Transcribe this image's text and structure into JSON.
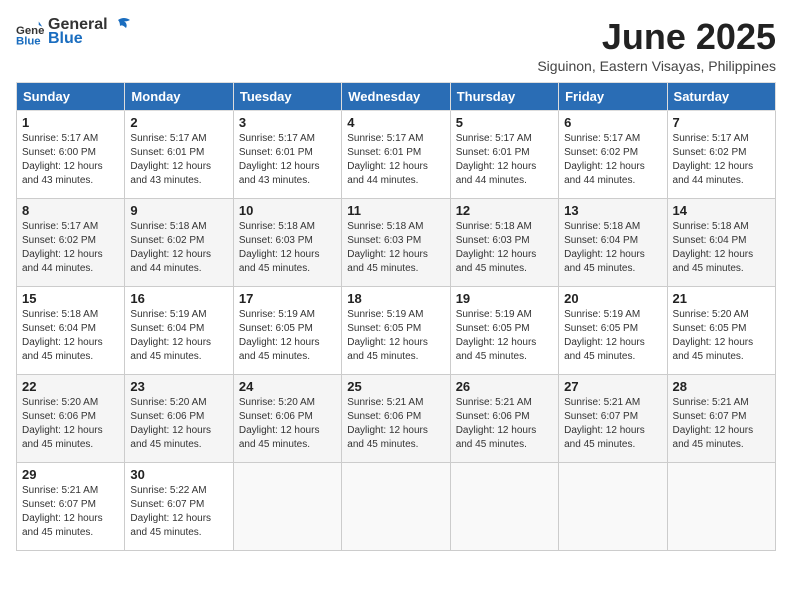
{
  "header": {
    "logo_general": "General",
    "logo_blue": "Blue",
    "month_title": "June 2025",
    "location": "Siguinon, Eastern Visayas, Philippines"
  },
  "weekdays": [
    "Sunday",
    "Monday",
    "Tuesday",
    "Wednesday",
    "Thursday",
    "Friday",
    "Saturday"
  ],
  "weeks": [
    [
      {
        "day": "1",
        "info": "Sunrise: 5:17 AM\nSunset: 6:00 PM\nDaylight: 12 hours\nand 43 minutes."
      },
      {
        "day": "2",
        "info": "Sunrise: 5:17 AM\nSunset: 6:01 PM\nDaylight: 12 hours\nand 43 minutes."
      },
      {
        "day": "3",
        "info": "Sunrise: 5:17 AM\nSunset: 6:01 PM\nDaylight: 12 hours\nand 43 minutes."
      },
      {
        "day": "4",
        "info": "Sunrise: 5:17 AM\nSunset: 6:01 PM\nDaylight: 12 hours\nand 44 minutes."
      },
      {
        "day": "5",
        "info": "Sunrise: 5:17 AM\nSunset: 6:01 PM\nDaylight: 12 hours\nand 44 minutes."
      },
      {
        "day": "6",
        "info": "Sunrise: 5:17 AM\nSunset: 6:02 PM\nDaylight: 12 hours\nand 44 minutes."
      },
      {
        "day": "7",
        "info": "Sunrise: 5:17 AM\nSunset: 6:02 PM\nDaylight: 12 hours\nand 44 minutes."
      }
    ],
    [
      {
        "day": "8",
        "info": "Sunrise: 5:17 AM\nSunset: 6:02 PM\nDaylight: 12 hours\nand 44 minutes."
      },
      {
        "day": "9",
        "info": "Sunrise: 5:18 AM\nSunset: 6:02 PM\nDaylight: 12 hours\nand 44 minutes."
      },
      {
        "day": "10",
        "info": "Sunrise: 5:18 AM\nSunset: 6:03 PM\nDaylight: 12 hours\nand 45 minutes."
      },
      {
        "day": "11",
        "info": "Sunrise: 5:18 AM\nSunset: 6:03 PM\nDaylight: 12 hours\nand 45 minutes."
      },
      {
        "day": "12",
        "info": "Sunrise: 5:18 AM\nSunset: 6:03 PM\nDaylight: 12 hours\nand 45 minutes."
      },
      {
        "day": "13",
        "info": "Sunrise: 5:18 AM\nSunset: 6:04 PM\nDaylight: 12 hours\nand 45 minutes."
      },
      {
        "day": "14",
        "info": "Sunrise: 5:18 AM\nSunset: 6:04 PM\nDaylight: 12 hours\nand 45 minutes."
      }
    ],
    [
      {
        "day": "15",
        "info": "Sunrise: 5:18 AM\nSunset: 6:04 PM\nDaylight: 12 hours\nand 45 minutes."
      },
      {
        "day": "16",
        "info": "Sunrise: 5:19 AM\nSunset: 6:04 PM\nDaylight: 12 hours\nand 45 minutes."
      },
      {
        "day": "17",
        "info": "Sunrise: 5:19 AM\nSunset: 6:05 PM\nDaylight: 12 hours\nand 45 minutes."
      },
      {
        "day": "18",
        "info": "Sunrise: 5:19 AM\nSunset: 6:05 PM\nDaylight: 12 hours\nand 45 minutes."
      },
      {
        "day": "19",
        "info": "Sunrise: 5:19 AM\nSunset: 6:05 PM\nDaylight: 12 hours\nand 45 minutes."
      },
      {
        "day": "20",
        "info": "Sunrise: 5:19 AM\nSunset: 6:05 PM\nDaylight: 12 hours\nand 45 minutes."
      },
      {
        "day": "21",
        "info": "Sunrise: 5:20 AM\nSunset: 6:05 PM\nDaylight: 12 hours\nand 45 minutes."
      }
    ],
    [
      {
        "day": "22",
        "info": "Sunrise: 5:20 AM\nSunset: 6:06 PM\nDaylight: 12 hours\nand 45 minutes."
      },
      {
        "day": "23",
        "info": "Sunrise: 5:20 AM\nSunset: 6:06 PM\nDaylight: 12 hours\nand 45 minutes."
      },
      {
        "day": "24",
        "info": "Sunrise: 5:20 AM\nSunset: 6:06 PM\nDaylight: 12 hours\nand 45 minutes."
      },
      {
        "day": "25",
        "info": "Sunrise: 5:21 AM\nSunset: 6:06 PM\nDaylight: 12 hours\nand 45 minutes."
      },
      {
        "day": "26",
        "info": "Sunrise: 5:21 AM\nSunset: 6:06 PM\nDaylight: 12 hours\nand 45 minutes."
      },
      {
        "day": "27",
        "info": "Sunrise: 5:21 AM\nSunset: 6:07 PM\nDaylight: 12 hours\nand 45 minutes."
      },
      {
        "day": "28",
        "info": "Sunrise: 5:21 AM\nSunset: 6:07 PM\nDaylight: 12 hours\nand 45 minutes."
      }
    ],
    [
      {
        "day": "29",
        "info": "Sunrise: 5:21 AM\nSunset: 6:07 PM\nDaylight: 12 hours\nand 45 minutes."
      },
      {
        "day": "30",
        "info": "Sunrise: 5:22 AM\nSunset: 6:07 PM\nDaylight: 12 hours\nand 45 minutes."
      },
      {
        "day": "",
        "info": ""
      },
      {
        "day": "",
        "info": ""
      },
      {
        "day": "",
        "info": ""
      },
      {
        "day": "",
        "info": ""
      },
      {
        "day": "",
        "info": ""
      }
    ]
  ]
}
